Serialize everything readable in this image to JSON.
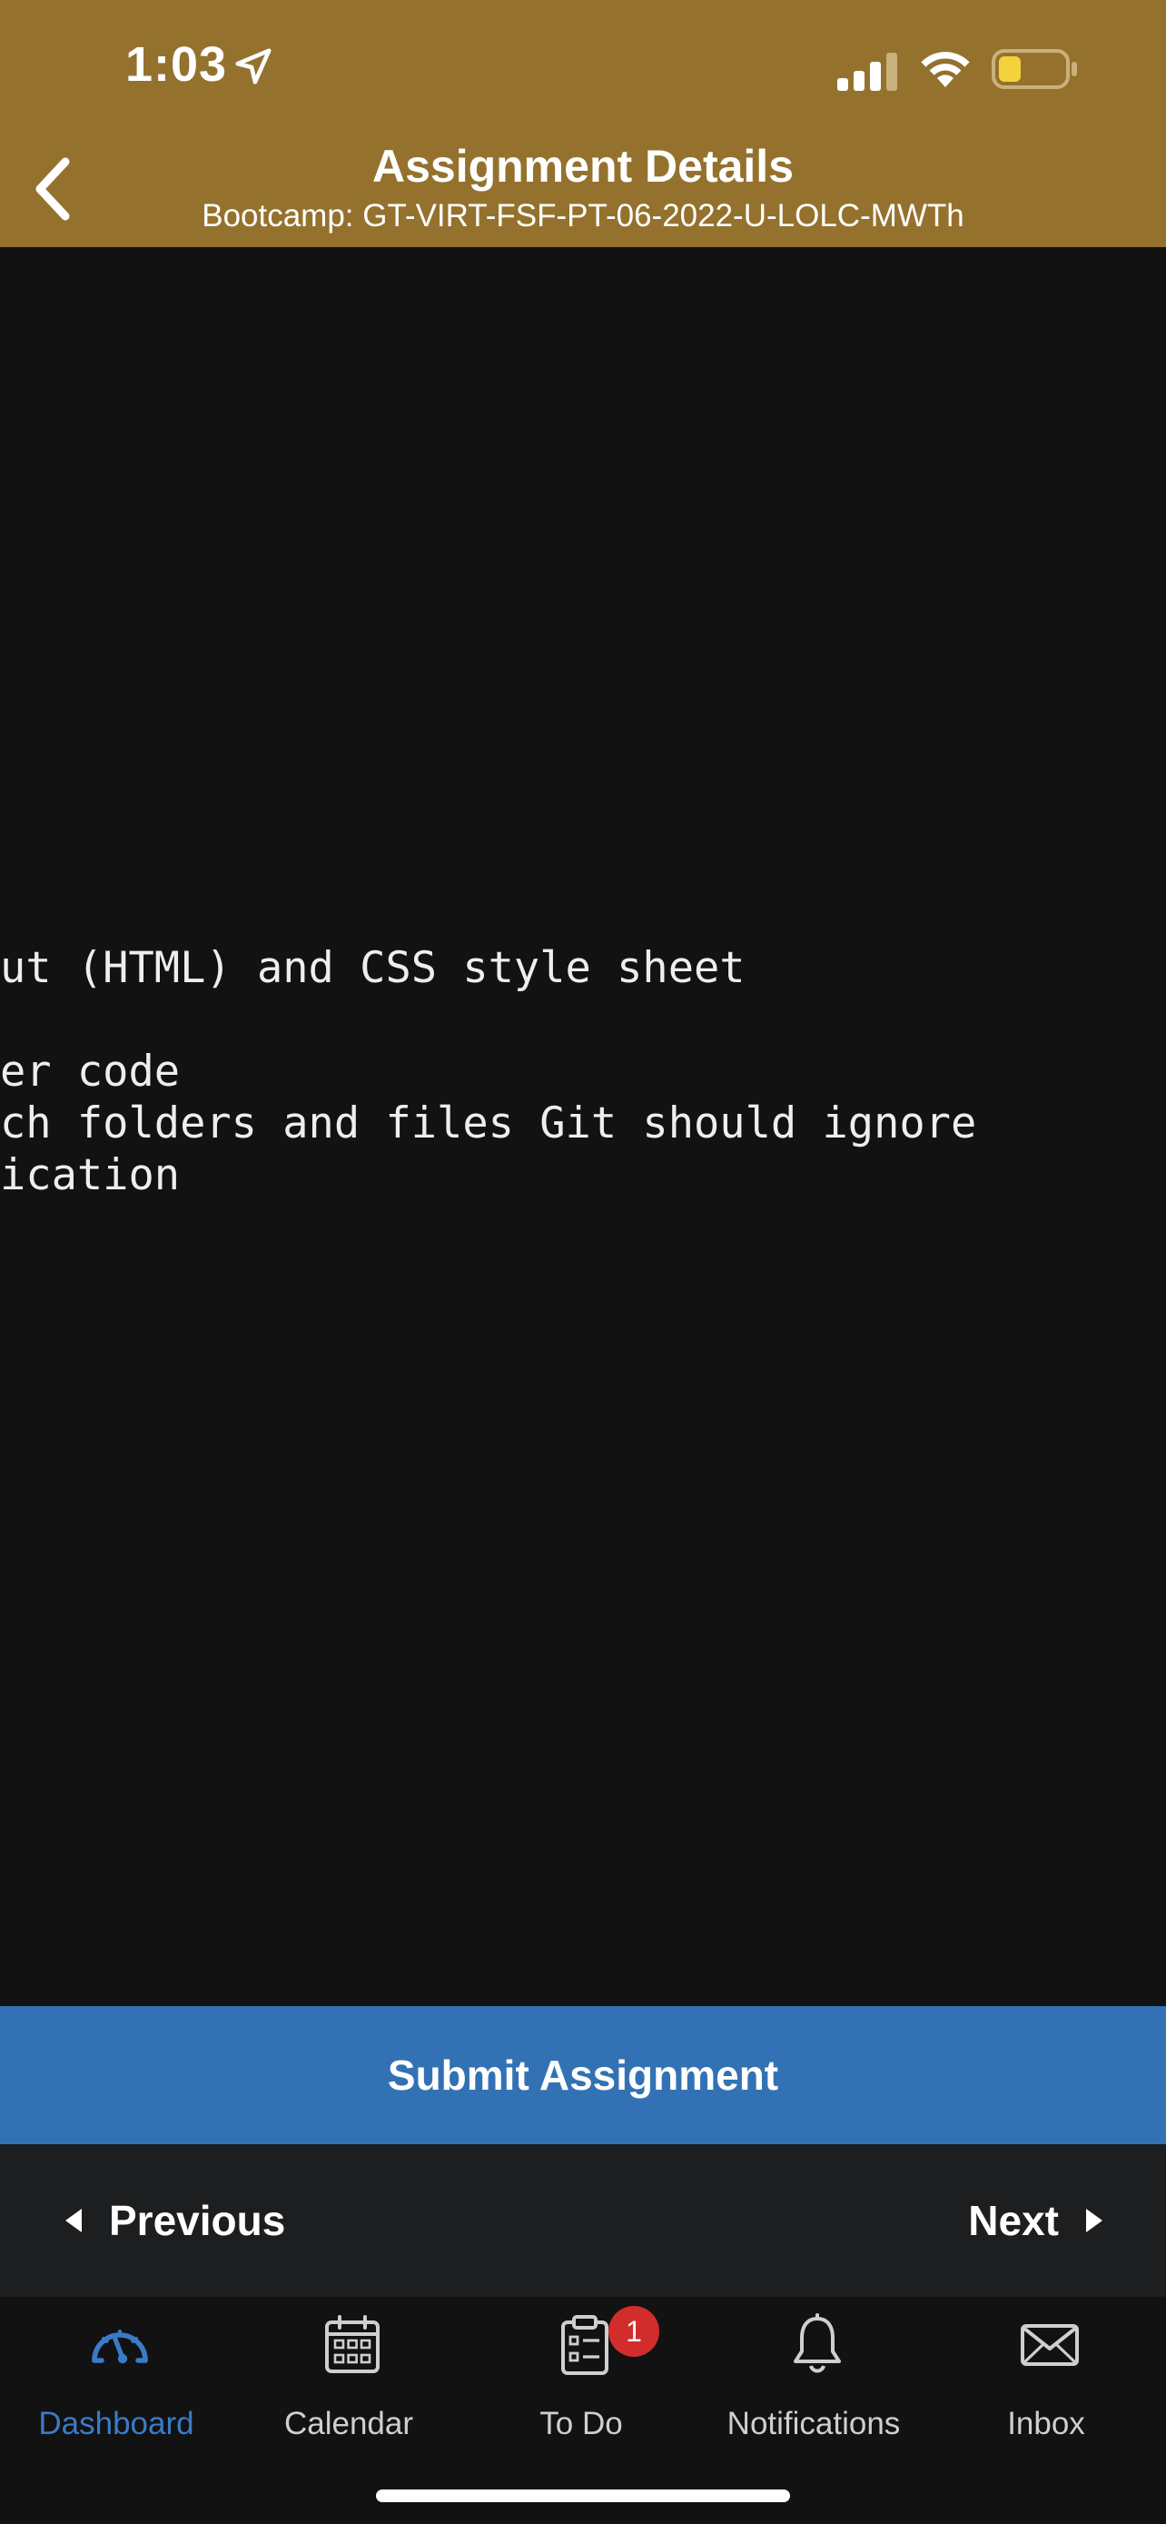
{
  "status_bar": {
    "time": "1:03",
    "battery_color": "#f5d23c"
  },
  "header": {
    "title": "Assignment Details",
    "subtitle": "Bootcamp: GT-VIRT-FSF-PT-06-2022-U-LOLC-MWTh",
    "background_color": "#94722e"
  },
  "content": {
    "lines": [
      "ut (HTML) and CSS style sheet",
      "er code",
      "ch folders and files Git should ignore",
      "ication"
    ]
  },
  "actions": {
    "submit_label": "Submit Assignment",
    "submit_color": "#3272b4"
  },
  "pager": {
    "previous_label": "Previous",
    "next_label": "Next"
  },
  "tabbar": {
    "active_color": "#3a7bc8",
    "tabs": [
      {
        "label": "Dashboard",
        "icon": "dashboard-icon",
        "active": true
      },
      {
        "label": "Calendar",
        "icon": "calendar-icon"
      },
      {
        "label": "To Do",
        "icon": "todo-icon",
        "badge": "1"
      },
      {
        "label": "Notifications",
        "icon": "bell-icon"
      },
      {
        "label": "Inbox",
        "icon": "envelope-icon"
      }
    ]
  }
}
